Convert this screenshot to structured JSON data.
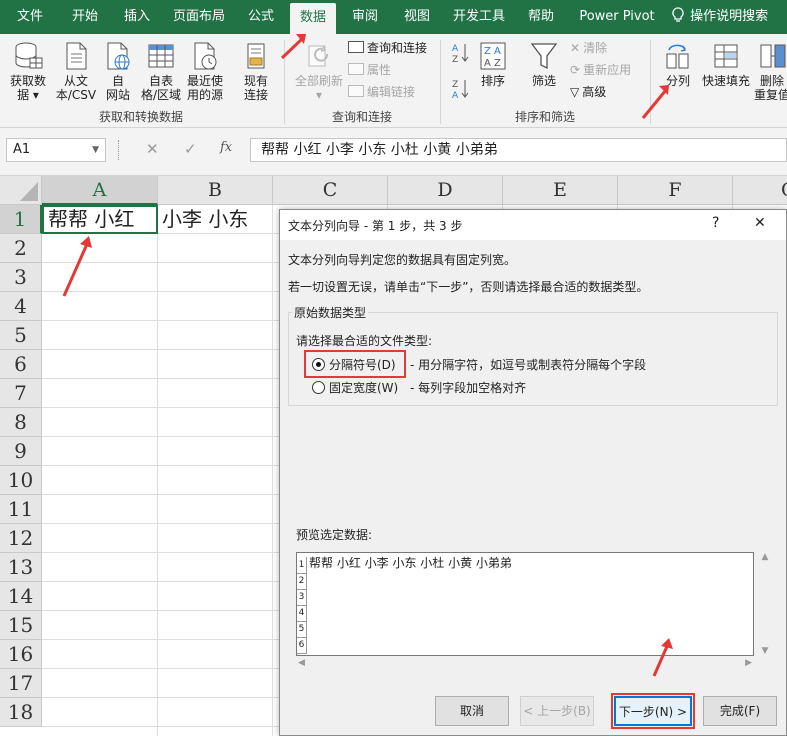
{
  "menu": {
    "tabs": [
      "文件",
      "开始",
      "插入",
      "页面布局",
      "公式",
      "数据",
      "审阅",
      "视图",
      "开发工具",
      "帮助",
      "Power Pivot"
    ],
    "active_tab": "数据",
    "tell_me": "操作说明搜索"
  },
  "ribbon": {
    "get_data": {
      "buttons": [
        {
          "l1": "获取数",
          "l2": "据 ▾"
        },
        {
          "l1": "从文",
          "l2": "本/CSV"
        },
        {
          "l1": "自",
          "l2": "网站"
        },
        {
          "l1": "自表",
          "l2": "格/区域"
        },
        {
          "l1": "最近使",
          "l2": "用的源"
        },
        {
          "l1": "现有",
          "l2": "连接"
        }
      ],
      "group_label": "获取和转换数据"
    },
    "queries": {
      "refresh_all_l1": "全部刷新",
      "refresh_all_l2": "▾",
      "queries_connections": "查询和连接",
      "properties": "属性",
      "edit_links": "编辑链接",
      "group_label": "查询和连接"
    },
    "sort_filter": {
      "sort": "排序",
      "filter": "筛选",
      "clear": "清除",
      "reapply": "重新应用",
      "advanced": "高级",
      "group_label": "排序和筛选"
    },
    "data_tools": {
      "text_to_columns": "分列",
      "flash_fill": "快速填充",
      "remove_dup_l1": "删除",
      "remove_dup_l2": "重复值"
    }
  },
  "formula_bar": {
    "name_box": "A1",
    "cancel": "✕",
    "enter": "✓",
    "fx": "fx",
    "content": "帮帮 小红 小李 小东 小杜 小黄 小弟弟"
  },
  "sheet": {
    "columns": [
      "A",
      "B",
      "C",
      "D",
      "E",
      "F",
      "G"
    ],
    "rows": [
      "1",
      "2",
      "3",
      "4",
      "5",
      "6",
      "7",
      "8",
      "9",
      "10",
      "11",
      "12",
      "13",
      "14",
      "15",
      "16",
      "17",
      "18"
    ],
    "a1_text": "帮帮  小红",
    "b1_text": "小李  小东"
  },
  "dialog": {
    "title": "文本分列向导 - 第 1 步，共 3 步",
    "help": "?",
    "close": "✕",
    "desc1": "文本分列向导判定您的数据具有固定列宽。",
    "desc2": "若一切设置无误，请单击“下一步”，否则请选择最合适的数据类型。",
    "group_title": "原始数据类型",
    "choose_label": "请选择最合适的文件类型:",
    "opt_delimited": "分隔符号(D)",
    "opt_delimited_desc": "- 用分隔字符，如逗号或制表符分隔每个字段",
    "opt_fixed": "固定宽度(W)",
    "opt_fixed_desc": "- 每列字段加空格对齐",
    "selected_option": "delimited",
    "preview_label": "预览选定数据:",
    "preview_rows": [
      {
        "n": "1",
        "text": "帮帮 小红 小李 小东 小杜 小黄 小弟弟"
      },
      {
        "n": "2",
        "text": ""
      },
      {
        "n": "3",
        "text": ""
      },
      {
        "n": "4",
        "text": ""
      },
      {
        "n": "5",
        "text": ""
      },
      {
        "n": "6",
        "text": ""
      }
    ],
    "buttons": {
      "cancel": "取消",
      "back": "< 上一步(B)",
      "next": "下一步(N) >",
      "finish": "完成(F)"
    }
  },
  "colors": {
    "excel_green": "#217346",
    "annotation_red": "#e53935",
    "focus_blue": "#0078d7"
  }
}
